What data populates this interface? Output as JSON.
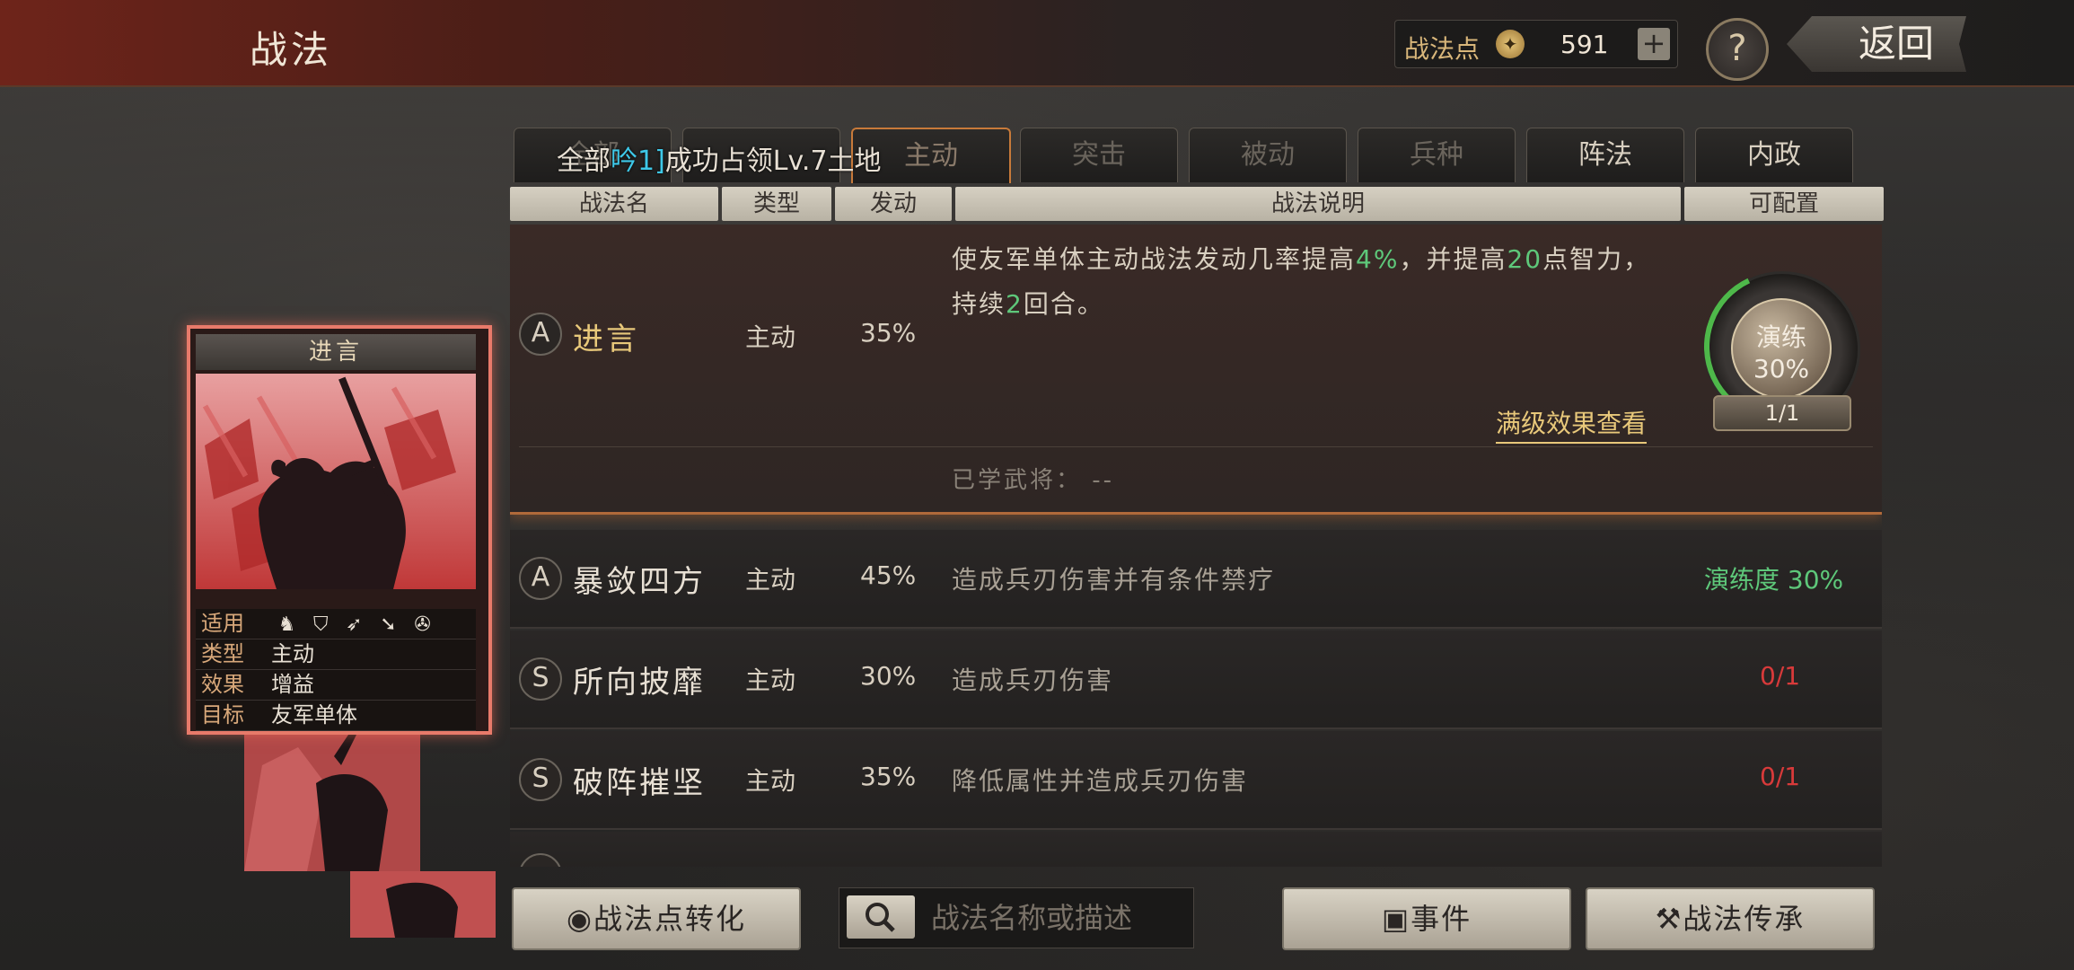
{
  "header": {
    "title": "战法",
    "points_label": "战法点",
    "points_value": "591",
    "add_label": "+",
    "help_label": "?",
    "back_label": "返回"
  },
  "tabs": [
    {
      "label": "全部"
    },
    {
      "label": ""
    },
    {
      "label": "主动"
    },
    {
      "label": "突击"
    },
    {
      "label": "被动"
    },
    {
      "label": "兵种"
    },
    {
      "label": "阵法"
    },
    {
      "label": "内政"
    }
  ],
  "overlay": {
    "prefix": "全部",
    "cyan": "吟1]",
    "rest": "成功占领Lv.7土地"
  },
  "columns": {
    "name": "战法名",
    "type": "类型",
    "rate": "发动",
    "desc": "战法说明",
    "status": "可配置"
  },
  "selected": {
    "grade": "A",
    "name": "进言",
    "type": "主动",
    "rate": "35%",
    "desc_parts": [
      "使友军单体主动战法发动几率提高",
      "4%",
      "，并提高",
      "20",
      "点智力，持续",
      "2",
      "回合。"
    ],
    "maxlevel_link": "满级效果查看",
    "learned_label": "已学武将：",
    "learned_value": "--",
    "drill_label": "演练",
    "drill_pct": "30%",
    "drill_progress": 0.3,
    "drill_count": "1/1"
  },
  "rows": [
    {
      "grade": "A",
      "name": "暴敛四方",
      "type": "主动",
      "rate": "45%",
      "desc": "造成兵刃伤害并有条件禁疗",
      "status": "演练度 30%",
      "status_color": "#5ec87a"
    },
    {
      "grade": "S",
      "name": "所向披靡",
      "type": "主动",
      "rate": "30%",
      "desc": "造成兵刃伤害",
      "status": "0/1",
      "status_color": "#d83a3a"
    },
    {
      "grade": "S",
      "name": "破阵摧坚",
      "type": "主动",
      "rate": "35%",
      "desc": "降低属性并造成兵刃伤害",
      "status": "0/1",
      "status_color": "#d83a3a"
    }
  ],
  "card": {
    "title": "进言",
    "apply_label": "适用",
    "apply_icons": [
      "cavalry-icon",
      "shield-icon",
      "bow-icon",
      "spear-icon",
      "wheel-icon"
    ],
    "type_label": "类型",
    "type_value": "主动",
    "effect_label": "效果",
    "effect_value": "增益",
    "target_label": "目标",
    "target_value": "友军单体"
  },
  "bottom": {
    "convert_label": "战法点转化",
    "search_placeholder": "战法名称或描述",
    "event_label": "事件",
    "inherit_label": "战法传承"
  },
  "colors": {
    "accent_gold": "#e8c87a",
    "highlight_green": "#5ec87a",
    "alert_red": "#d83a3a",
    "card_border": "#e87a6a"
  }
}
